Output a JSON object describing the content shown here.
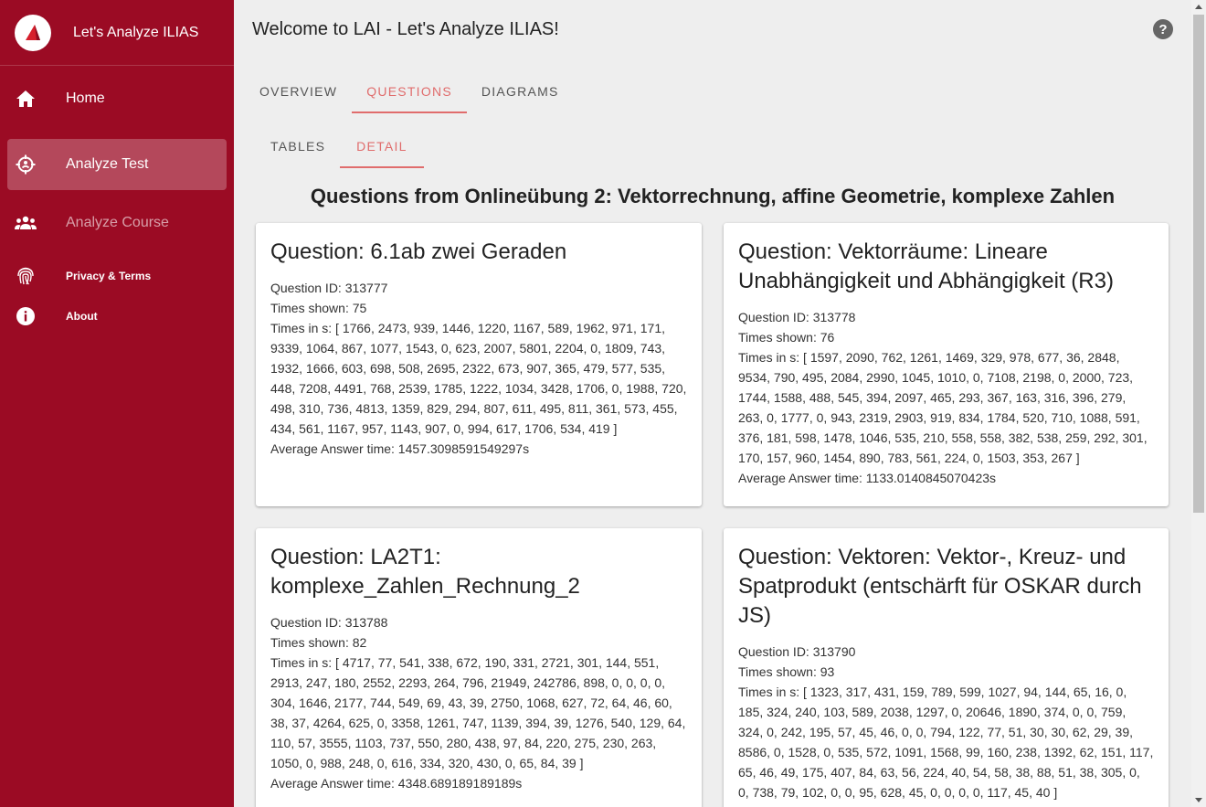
{
  "sidebar": {
    "brand_title": "Let's Analyze ILIAS",
    "items": [
      {
        "label": "Home",
        "icon": "home-icon"
      },
      {
        "label": "Analyze Test",
        "icon": "crosshair-icon"
      },
      {
        "label": "Analyze Course",
        "icon": "group-icon"
      },
      {
        "label": "Privacy & Terms",
        "icon": "fingerprint-icon"
      },
      {
        "label": "About",
        "icon": "info-icon"
      }
    ]
  },
  "header": {
    "title": "Welcome to LAI - Let's Analyze ILIAS!",
    "help_symbol": "?"
  },
  "tabs": {
    "main": [
      "OVERVIEW",
      "QUESTIONS",
      "DIAGRAMS"
    ],
    "main_active": "QUESTIONS",
    "sub": [
      "TABLES",
      "DETAIL"
    ],
    "sub_active": "DETAIL"
  },
  "page_heading": "Questions from Onlineübung 2: Vektorrechnung, affine Geometrie, komplexe Zahlen",
  "cards": [
    {
      "title": "Question: 6.1ab zwei Geraden",
      "question_id": "Question ID: 313777",
      "times_shown": "Times shown: 75",
      "times_in_s": "Times in s: [ 1766, 2473, 939, 1446, 1220, 1167, 589, 1962, 971, 171, 9339, 1064, 867, 1077, 1543, 0, 623, 2007, 5801, 2204, 0, 1809, 743, 1932, 1666, 603, 698, 508, 2695, 2322, 673, 907, 365, 479, 577, 535, 448, 7208, 4491, 768, 2539, 1785, 1222, 1034, 3428, 1706, 0, 1988, 720, 498, 310, 736, 4813, 1359, 829, 294, 807, 611, 495, 811, 361, 573, 455, 434, 561, 1167, 957, 1143, 907, 0, 994, 617, 1706, 534, 419 ]",
      "average": "Average Answer time: 1457.3098591549297s"
    },
    {
      "title": "Question: Vektorräume: Lineare Unabhängigkeit und Abhängigkeit (R3)",
      "question_id": "Question ID: 313778",
      "times_shown": "Times shown: 76",
      "times_in_s": "Times in s: [ 1597, 2090, 762, 1261, 1469, 329, 978, 677, 36, 2848, 9534, 790, 495, 2084, 2990, 1045, 1010, 0, 7108, 2198, 0, 2000, 723, 1744, 1588, 488, 545, 394, 2097, 465, 293, 367, 163, 316, 396, 279, 263, 0, 1777, 0, 943, 2319, 2903, 919, 834, 1784, 520, 710, 1088, 591, 376, 181, 598, 1478, 1046, 535, 210, 558, 558, 382, 538, 259, 292, 301, 170, 157, 960, 1454, 890, 783, 561, 224, 0, 1503, 353, 267 ]",
      "average": "Average Answer time: 1133.0140845070423s"
    },
    {
      "title": "Question: LA2T1: komplexe_Zahlen_Rechnung_2",
      "question_id": "Question ID: 313788",
      "times_shown": "Times shown: 82",
      "times_in_s": "Times in s: [ 4717, 77, 541, 338, 672, 190, 331, 2721, 301, 144, 551, 2913, 247, 180, 2552, 2293, 264, 796, 21949, 242786, 898, 0, 0, 0, 0, 304, 1646, 2177, 744, 549, 69, 43, 39, 2750, 1068, 627, 72, 64, 46, 60, 38, 37, 4264, 625, 0, 3358, 1261, 747, 1139, 394, 39, 1276, 540, 129, 64, 110, 57, 3555, 1103, 737, 550, 280, 438, 97, 84, 220, 275, 230, 263, 1050, 0, 988, 248, 0, 616, 334, 320, 430, 0, 65, 84, 39 ]",
      "average": "Average Answer time: 4348.689189189189s"
    },
    {
      "title": "Question: Vektoren: Vektor-, Kreuz- und Spatprodukt (entschärft für OSKAR durch JS)",
      "question_id": "Question ID: 313790",
      "times_shown": "Times shown: 93",
      "times_in_s": "Times in s: [ 1323, 317, 431, 159, 789, 599, 1027, 94, 144, 65, 16, 0, 185, 324, 240, 103, 589, 2038, 1297, 0, 20646, 1890, 374, 0, 0, 759, 324, 0, 242, 195, 57, 45, 46, 0, 0, 794, 122, 77, 51, 30, 30, 62, 29, 39, 8586, 0, 1528, 0, 535, 572, 1091, 1568, 99, 160, 238, 1392, 62, 151, 117, 65, 46, 49, 175, 407, 84, 63, 56, 224, 40, 54, 58, 38, 88, 51, 38, 305, 0, 0, 738, 79, 102, 0, 0, 95, 628, 45, 0, 0, 0, 0, 117, 45, 40 ]",
      "average": ""
    }
  ]
}
